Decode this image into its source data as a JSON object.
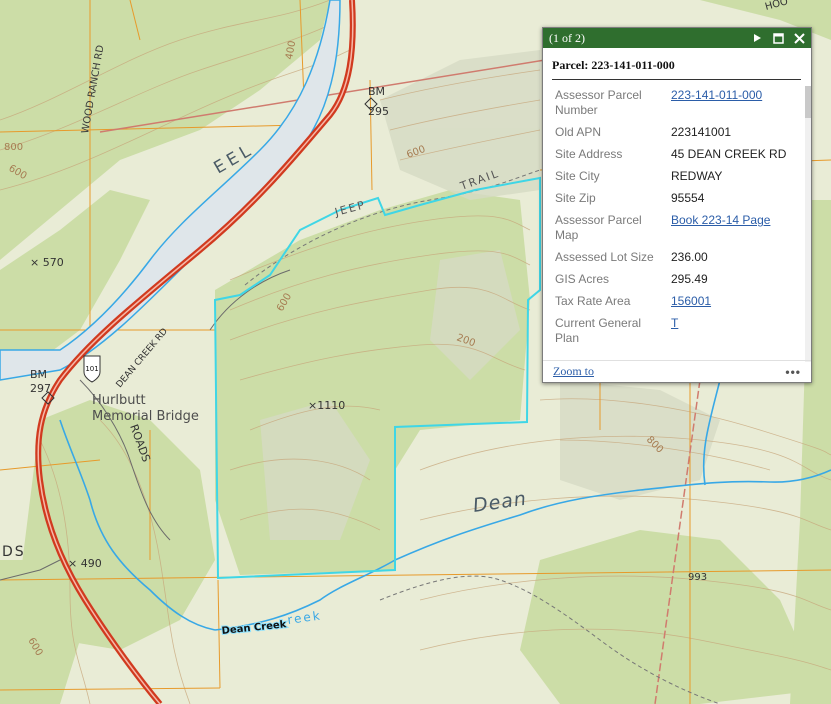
{
  "map": {
    "labels": {
      "wood_ranch_rd": "WOOD RANCH RD",
      "eel": "EEL",
      "bm_295": "BM",
      "bm_295_num": "295",
      "bm_297": "BM",
      "bm_297_num": "297",
      "x570": "× 570",
      "jeep": "JEEP",
      "trail": "TRAIL",
      "route_101": "101",
      "dean_creek_rd": "DEAN CREEK RD",
      "hurlbutt": "Hurlbutt",
      "memorial_bridge": "Memorial Bridge",
      "roads": "ROADS",
      "x1110": "×1110",
      "dean": "Dean",
      "x490": "× 490",
      "dean_creek_label": "Dean Creek",
      "creek": "reek",
      "x993": "993",
      "c600a": "600",
      "c600b": "600",
      "c600c": "600",
      "c800a": "800",
      "c800b": "800",
      "c200": "200",
      "c400": "400",
      "c600d": "600",
      "ds": "DS",
      "hoo": "HOO"
    },
    "colors": {
      "terrain": "#e8edd3",
      "vegetation": "#c9dca2",
      "river": "#38a8e6",
      "highway": "#d13a1f",
      "parcel_outline": "#3fd6e6",
      "parcel_lines": "#e79a2b",
      "contour": "#b8905c"
    }
  },
  "popup": {
    "count": "(1 of 2)",
    "title": "Parcel: 223-141-011-000",
    "rows": [
      {
        "label": "Assessor Parcel Number",
        "value": "223-141-011-000",
        "link": true
      },
      {
        "label": "Old APN",
        "value": "223141001",
        "link": false
      },
      {
        "label": "Site Address",
        "value": "45 DEAN CREEK RD",
        "link": false
      },
      {
        "label": "Site City",
        "value": "REDWAY",
        "link": false
      },
      {
        "label": "Site Zip",
        "value": "95554",
        "link": false
      },
      {
        "label": "Assessor Parcel Map",
        "value": "Book 223-14 Page",
        "link": true
      },
      {
        "label": "Assessed Lot Size",
        "value": "236.00",
        "link": false
      },
      {
        "label": "GIS Acres",
        "value": "295.49",
        "link": false
      },
      {
        "label": "Tax Rate Area",
        "value": "156001",
        "link": true
      },
      {
        "label": "Current General Plan",
        "value": "T",
        "link": true
      }
    ],
    "zoom_to": "Zoom to",
    "more": "•••",
    "icons": {
      "next": "play-icon",
      "maximize": "maximize-icon",
      "close": "close-icon"
    }
  }
}
